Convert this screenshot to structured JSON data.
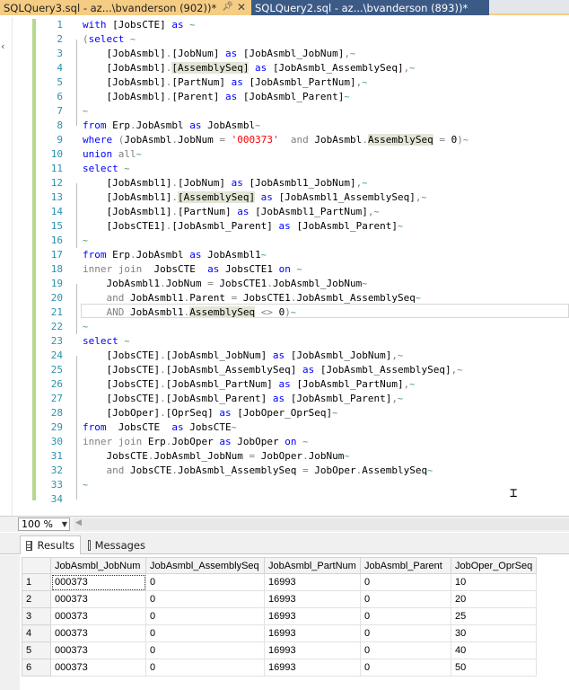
{
  "tabs": [
    {
      "title": "SQLQuery3.sql - az...\\bvanderson (902))*",
      "active": true
    },
    {
      "title": "SQLQuery2.sql - az...\\bvanderson (893))*",
      "active": false
    }
  ],
  "editor": {
    "line_numbers": [
      "1",
      "2",
      "3",
      "4",
      "5",
      "6",
      "7",
      "8",
      "9",
      "10",
      "11",
      "12",
      "13",
      "14",
      "15",
      "16",
      "17",
      "18",
      "19",
      "20",
      "21",
      "22",
      "23",
      "24",
      "25",
      "26",
      "27",
      "28",
      "29",
      "30",
      "31",
      "32",
      "33",
      "34"
    ]
  },
  "zoom": {
    "value": "100 %"
  },
  "result_tabs": {
    "results": "Results",
    "messages": "Messages"
  },
  "grid": {
    "columns": [
      "JobAsmbl_JobNum",
      "JobAsmbl_AssemblySeq",
      "JobAsmbl_PartNum",
      "JobAsmbl_Parent",
      "JobOper_OprSeq"
    ],
    "rows": [
      {
        "n": "1",
        "cells": [
          "000373",
          "0",
          "16993",
          "0",
          "10"
        ]
      },
      {
        "n": "2",
        "cells": [
          "000373",
          "0",
          "16993",
          "0",
          "20"
        ]
      },
      {
        "n": "3",
        "cells": [
          "000373",
          "0",
          "16993",
          "0",
          "25"
        ]
      },
      {
        "n": "4",
        "cells": [
          "000373",
          "0",
          "16993",
          "0",
          "30"
        ]
      },
      {
        "n": "5",
        "cells": [
          "000373",
          "0",
          "16993",
          "0",
          "40"
        ]
      },
      {
        "n": "6",
        "cells": [
          "000373",
          "0",
          "16993",
          "0",
          "50"
        ]
      }
    ]
  },
  "code": {
    "l1": {
      "a": "with",
      "b": " [JobsCTE] ",
      "c": "as"
    },
    "l2": {
      "a": "(",
      "b": "select"
    },
    "l3": {
      "a": "    [JobAsmbl]",
      "b": ".",
      "c": "[JobNum]",
      "d": " as ",
      "e": "[JobAsmbl_JobNum]",
      "f": ","
    },
    "l4": {
      "a": "    [JobAsmbl]",
      "b": ".",
      "c": "[AssemblySeq]",
      "d": " as ",
      "e": "[JobAsmbl_AssemblySeq]",
      "f": ","
    },
    "l5": {
      "a": "    [JobAsmbl]",
      "b": ".",
      "c": "[PartNum]",
      "d": " as ",
      "e": "[JobAsmbl_PartNum]",
      "f": ","
    },
    "l6": {
      "a": "    [JobAsmbl]",
      "b": ".",
      "c": "[Parent]",
      "d": " as ",
      "e": "[JobAsmbl_Parent]"
    },
    "l8": {
      "a": "from",
      "b": " Erp",
      "c": ".",
      "d": "JobAsmbl ",
      "e": "as",
      "f": " JobAsmbl"
    },
    "l9": {
      "a": "where",
      "b": " (",
      "c": "JobAsmbl",
      "d": ".",
      "e": "JobNum ",
      "f": "=",
      "g": " '000373'",
      "h": "  and",
      "i": " JobAsmbl",
      "j": ".",
      "k": "AssemblySeq",
      "l": " = ",
      "m": "0",
      "n": ")"
    },
    "l10": {
      "a": "union",
      "b": " all"
    },
    "l11": {
      "a": "select"
    },
    "l12": {
      "a": "    [JobAsmbl1]",
      "b": ".",
      "c": "[JobNum]",
      "d": " as ",
      "e": "[JobAsmbl1_JobNum]",
      "f": ","
    },
    "l13": {
      "a": "    [JobAsmbl1]",
      "b": ".",
      "c": "[AssemblySeq]",
      "d": " as ",
      "e": "[JobAsmbl1_AssemblySeq]",
      "f": ","
    },
    "l14": {
      "a": "    [JobAsmbl1]",
      "b": ".",
      "c": "[PartNum]",
      "d": " as ",
      "e": "[JobAsmbl1_PartNum]",
      "f": ","
    },
    "l15": {
      "a": "    [JobsCTE1]",
      "b": ".",
      "c": "[JobAsmbl_Parent]",
      "d": " as ",
      "e": "[JobAsmbl_Parent]"
    },
    "l17": {
      "a": "from",
      "b": " Erp",
      "c": ".",
      "d": "JobAsmbl ",
      "e": "as",
      "f": " JobAsmbl1"
    },
    "l18": {
      "a": "inner join",
      "b": "  JobsCTE  ",
      "c": "as",
      "d": " JobsCTE1 ",
      "e": "on"
    },
    "l19": {
      "a": "    JobAsmbl1",
      "b": ".",
      "c": "JobNum ",
      "d": "=",
      "e": " JobsCTE1",
      "f": ".",
      "g": "JobAsmbl_JobNum"
    },
    "l20": {
      "a": "    and",
      "b": " JobAsmbl1",
      "c": ".",
      "d": "Parent ",
      "e": "=",
      "f": " JobsCTE1",
      "g": ".",
      "h": "JobAsmbl_AssemblySeq"
    },
    "l21": {
      "a": "    AND",
      "b": " JobAsmbl1",
      "c": ".",
      "d": "AssemblySeq",
      "e": " <> ",
      "f": "0",
      "g": ")"
    },
    "l23": {
      "a": "select"
    },
    "l24": {
      "a": "    [JobsCTE]",
      "b": ".",
      "c": "[JobAsmbl_JobNum]",
      "d": " as ",
      "e": "[JobAsmbl_JobNum]",
      "f": ","
    },
    "l25": {
      "a": "    [JobsCTE]",
      "b": ".",
      "c": "[JobAsmbl_AssemblySeq]",
      "d": " as ",
      "e": "[JobAsmbl_AssemblySeq]",
      "f": ","
    },
    "l26": {
      "a": "    [JobsCTE]",
      "b": ".",
      "c": "[JobAsmbl_PartNum]",
      "d": " as ",
      "e": "[JobAsmbl_PartNum]",
      "f": ","
    },
    "l27": {
      "a": "    [JobsCTE]",
      "b": ".",
      "c": "[JobAsmbl_Parent]",
      "d": " as ",
      "e": "[JobAsmbl_Parent]",
      "f": ","
    },
    "l28": {
      "a": "    [JobOper]",
      "b": ".",
      "c": "[OprSeq]",
      "d": " as ",
      "e": "[JobOper_OprSeq]"
    },
    "l29": {
      "a": "from",
      "b": "  JobsCTE  ",
      "c": "as",
      "d": " JobsCTE"
    },
    "l30": {
      "a": "inner join",
      "b": " Erp",
      "c": ".",
      "d": "JobOper ",
      "e": "as",
      "f": " JobOper ",
      "g": "on"
    },
    "l31": {
      "a": "    JobsCTE",
      "b": ".",
      "c": "JobAsmbl_JobNum ",
      "d": "=",
      "e": " JobOper",
      "f": ".",
      "g": "JobNum"
    },
    "l32": {
      "a": "    and",
      "b": " JobsCTE",
      "c": ".",
      "d": "JobAsmbl_AssemblySeq ",
      "e": "=",
      "f": " JobOper",
      "g": ".",
      "h": "AssemblySeq"
    }
  }
}
